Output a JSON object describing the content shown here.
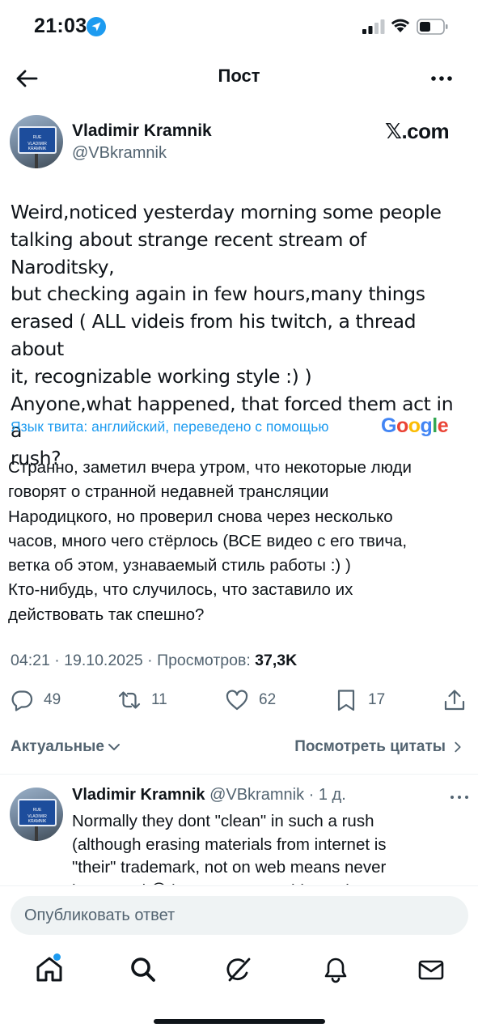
{
  "status_bar": {
    "time": "21:03"
  },
  "header": {
    "title": "Пост"
  },
  "post": {
    "author_name": "Vladimir Kramnik",
    "author_handle": "@VBkramnik",
    "avatar_sign_line1": "RUE",
    "avatar_sign_line2": "VLADIMIR KRAMNIK",
    "source_badge": "𝕏.com",
    "text": "Weird,noticed yesterday morning some people\ntalking about strange recent stream of Naroditsky,\nbut checking again in few hours,many things\nerased ( ALL videis from his twitch, a thread about\nit, recognizable working style :) )\nAnyone,what happened, that forced them act in a\nrush?",
    "translation_note": "Язык твита: английский, переведено с помощью",
    "translation_provider": "Google",
    "translated_text": "Странно, заметил вчера утром, что некоторые люди\nговорят о странной недавней трансляции\nНародицкого, но проверил снова через несколько\nчасов, много чего стёрлось (ВСЕ видео с его твича,\nветка об этом, узнаваемый стиль работы :) )\nКто-нибудь, что случилось, что заставило их\nдействовать так спешно?",
    "timestamp": "04:21 · 19.10.2025 · ",
    "views_label": "Просмотров: ",
    "views_count": "37,3K",
    "stats": {
      "replies": "49",
      "reposts": "11",
      "likes": "62",
      "bookmarks": "17"
    }
  },
  "replies_filter": {
    "label": "Актуальные",
    "quotes_link": "Посмотреть цитаты"
  },
  "reply": {
    "author_name": "Vladimir Kramnik",
    "author_handle": "@VBkramnik",
    "age": " · 1 д.",
    "text": "Normally they dont \"clean\" in such a rush\n(although erasing materials from internet is\n\"their\" trademark, not on web means never\nhappened 😉 ) , not to say nothing quite"
  },
  "compose": {
    "placeholder": "Опубликовать ответ"
  },
  "colors": {
    "accent": "#1d9bf0",
    "text": "#0f1419",
    "secondary": "#536471"
  }
}
